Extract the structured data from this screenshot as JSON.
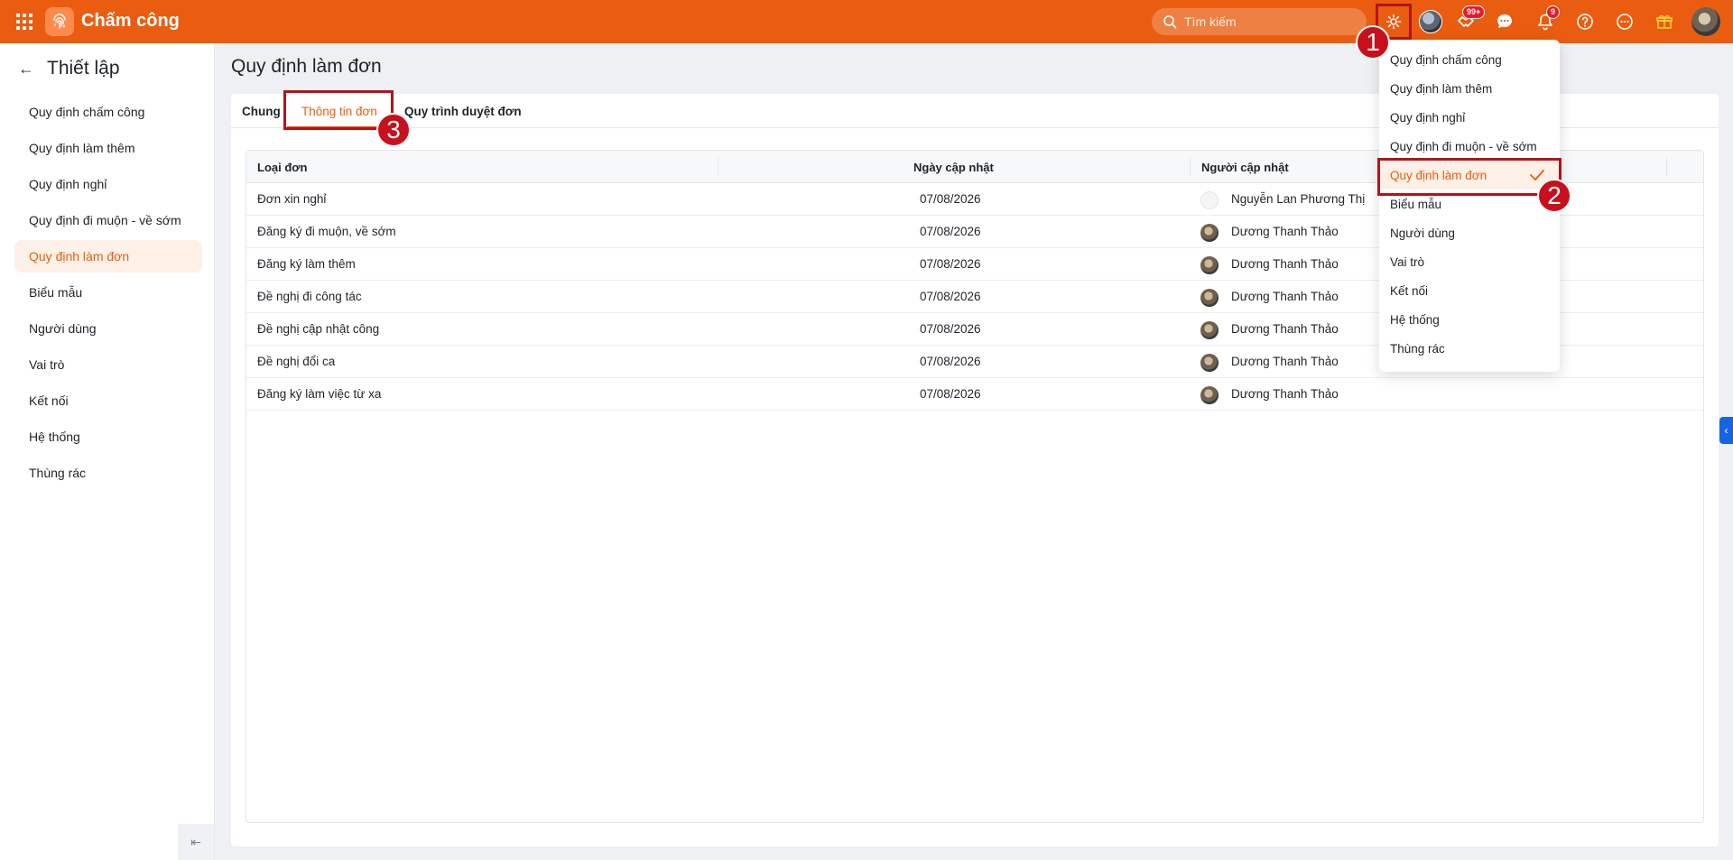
{
  "header": {
    "app_title": "Chấm công",
    "search_placeholder": "Tìm kiếm",
    "apps_badge": "99+",
    "notifications_badge": "9",
    "brand_color": "#ea5d10"
  },
  "sidebar": {
    "title": "Thiết lập",
    "items": [
      {
        "label": "Quy định chấm công"
      },
      {
        "label": "Quy định làm thêm"
      },
      {
        "label": "Quy định nghỉ"
      },
      {
        "label": "Quy định đi muộn - về sớm"
      },
      {
        "label": "Quy định làm đơn"
      },
      {
        "label": "Biểu mẫu"
      },
      {
        "label": "Người dùng"
      },
      {
        "label": "Vai trò"
      },
      {
        "label": "Kết nối"
      },
      {
        "label": "Hệ thống"
      },
      {
        "label": "Thùng rác"
      }
    ],
    "active_item": "Quy định làm đơn"
  },
  "main": {
    "title": "Quy định làm đơn",
    "tabs": [
      {
        "label": "Chung"
      },
      {
        "label": "Thông tin đơn"
      },
      {
        "label": "Quy trình duyệt đơn"
      }
    ],
    "active_tab": "Thông tin đơn",
    "table": {
      "columns": [
        "Loại đơn",
        "Ngày cập nhật",
        "Người cập nhật"
      ],
      "rows": [
        {
          "type": "Đơn xin nghỉ",
          "date": "07/08/2026",
          "user": "Nguyễn Lan Phương Thị"
        },
        {
          "type": "Đăng ký đi muộn, về sớm",
          "date": "07/08/2026",
          "user": "Dương Thanh Thảo"
        },
        {
          "type": "Đăng ký làm thêm",
          "date": "07/08/2026",
          "user": "Dương Thanh Thảo"
        },
        {
          "type": "Đề nghị đi công tác",
          "date": "07/08/2026",
          "user": "Dương Thanh Thảo"
        },
        {
          "type": "Đề nghị cập nhật công",
          "date": "07/08/2026",
          "user": "Dương Thanh Thảo"
        },
        {
          "type": "Đề nghị đổi ca",
          "date": "07/08/2026",
          "user": "Dương Thanh Thảo"
        },
        {
          "type": "Đăng ký làm việc từ xa",
          "date": "07/08/2026",
          "user": "Dương Thanh Thảo"
        }
      ]
    }
  },
  "settings_menu": {
    "items": [
      {
        "label": "Quy định chấm công"
      },
      {
        "label": "Quy định làm thêm"
      },
      {
        "label": "Quy định nghỉ"
      },
      {
        "label": "Quy định đi muộn - về sớm"
      },
      {
        "label": "Quy định làm đơn"
      },
      {
        "label": "Biểu mẫu"
      },
      {
        "label": "Người dùng"
      },
      {
        "label": "Vai trò"
      },
      {
        "label": "Kết nối"
      },
      {
        "label": "Hệ thống"
      },
      {
        "label": "Thùng rác"
      }
    ],
    "selected": "Quy định làm đơn"
  },
  "annotations": {
    "step1": "1",
    "step2": "2",
    "step3": "3",
    "highlight_color": "#b3141a"
  }
}
